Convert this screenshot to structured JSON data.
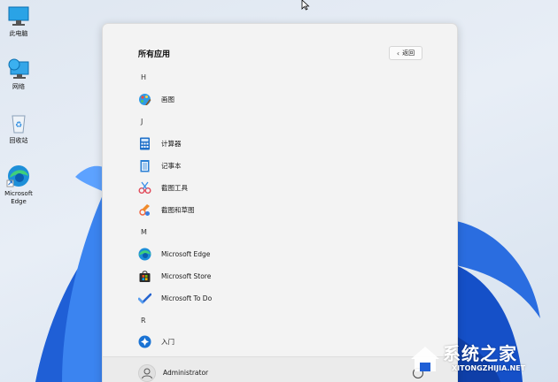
{
  "desktop": {
    "icons": [
      {
        "label": "此电脑",
        "icon": "computer-icon"
      },
      {
        "label": "网络",
        "icon": "network-icon"
      },
      {
        "label": "回收站",
        "icon": "recycle-bin-icon"
      },
      {
        "label": "Microsoft Edge",
        "icon": "edge-icon"
      }
    ]
  },
  "start_menu": {
    "title": "所有应用",
    "back_label": "返回",
    "groups": [
      {
        "letter": "H",
        "apps": [
          {
            "name": "画图",
            "icon": "paint-icon"
          }
        ]
      },
      {
        "letter": "J",
        "apps": [
          {
            "name": "计算器",
            "icon": "calculator-icon"
          },
          {
            "name": "记事本",
            "icon": "notepad-icon"
          },
          {
            "name": "截图工具",
            "icon": "snipping-tool-icon"
          },
          {
            "name": "截图和草图",
            "icon": "snip-sketch-icon"
          }
        ]
      },
      {
        "letter": "M",
        "apps": [
          {
            "name": "Microsoft Edge",
            "icon": "edge-icon"
          },
          {
            "name": "Microsoft Store",
            "icon": "store-icon"
          },
          {
            "name": "Microsoft To Do",
            "icon": "todo-icon"
          }
        ]
      },
      {
        "letter": "R",
        "apps": [
          {
            "name": "入门",
            "icon": "get-started-icon"
          }
        ]
      }
    ],
    "user": {
      "name": "Administrator"
    }
  },
  "watermark": {
    "title": "系统之家",
    "url": "XITONGZHIJIA.NET"
  },
  "colors": {
    "menu_bg": "#f3f3f3",
    "accent": "#0a64d8"
  }
}
